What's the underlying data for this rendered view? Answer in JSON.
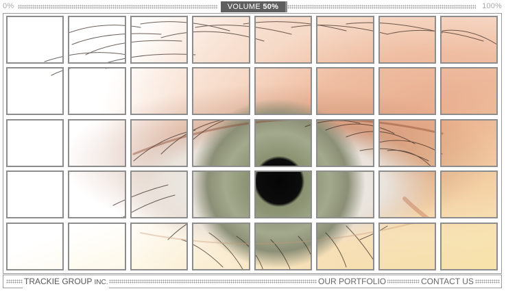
{
  "volume": {
    "min_label": "0%",
    "max_label": "100%",
    "label": "VOLUME",
    "value": "50%"
  },
  "nav": {
    "brand_main": "TRACKIE GROUP",
    "brand_suffix": "INC.",
    "portfolio": "OUR PORTFOLIO",
    "contact": "CONTACT US"
  },
  "grid": {
    "columns": 8,
    "rows": 5
  },
  "colors": {
    "accent": "#5f5f5f",
    "grid_line": "#8c8c8c",
    "dots": "#9a9a9a"
  },
  "photo": {
    "subject": "eye"
  }
}
